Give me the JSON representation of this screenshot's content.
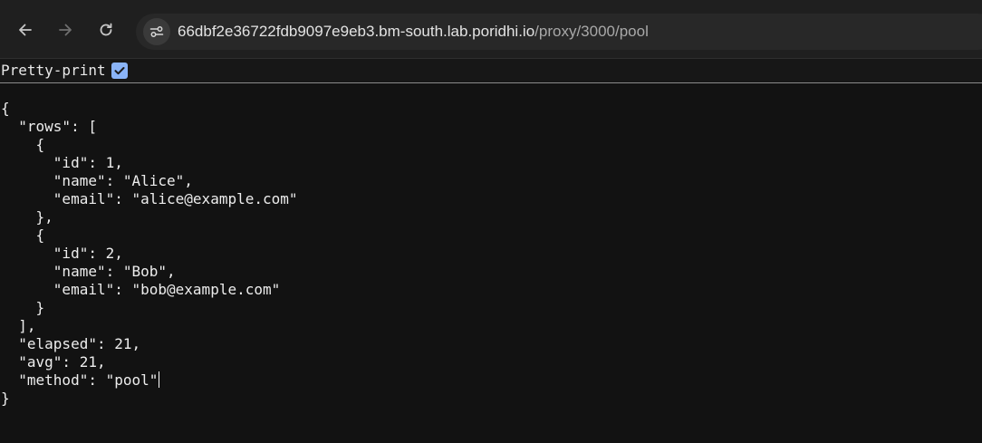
{
  "toolbar": {
    "back_icon": "arrow-left-icon",
    "forward_icon": "arrow-right-icon",
    "reload_icon": "reload-icon",
    "site_info_icon": "tune-icon"
  },
  "address_bar": {
    "host": "66dbf2e36722fdb9097e9eb3.bm-south.lab.poridhi.io",
    "path": "/proxy/3000/pool"
  },
  "pretty_print": {
    "label": "Pretty-print",
    "checked": true
  },
  "json_view": {
    "text": "{\n  \"rows\": [\n    {\n      \"id\": 1,\n      \"name\": \"Alice\",\n      \"email\": \"alice@example.com\"\n    },\n    {\n      \"id\": 2,\n      \"name\": \"Bob\",\n      \"email\": \"bob@example.com\"\n    }\n  ],\n  \"elapsed\": 21,\n  \"avg\": 21,\n  \"method\": \"pool\"",
    "closing": "\n}"
  },
  "colors": {
    "page_background": "#121212",
    "toolbar_background": "#1f1f1f",
    "omnibox_background": "#282828",
    "checkbox_accent": "#8ab4f8"
  }
}
